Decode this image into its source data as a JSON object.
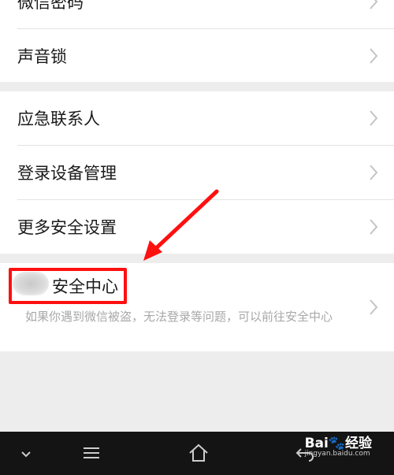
{
  "group1": {
    "items": [
      {
        "label": "微信密码"
      },
      {
        "label": "声音锁"
      }
    ]
  },
  "group2": {
    "items": [
      {
        "label": "应急联系人"
      },
      {
        "label": "登录设备管理"
      },
      {
        "label": "更多安全设置"
      }
    ]
  },
  "security_center": {
    "title": "安全中心",
    "description": "如果你遇到微信被盗，无法登录等问题，可以前往安全中心"
  },
  "watermark": {
    "brand": "Bai🐾经验",
    "url": "jingyan.baidu.com"
  },
  "colors": {
    "accent_red": "#ff1010",
    "background": "#ededed",
    "navbar": "#141414"
  },
  "icons": [
    "chevron-right-icon",
    "chevron-down-icon",
    "menu-icon",
    "home-icon",
    "back-icon",
    "red-arrow-annotation"
  ]
}
